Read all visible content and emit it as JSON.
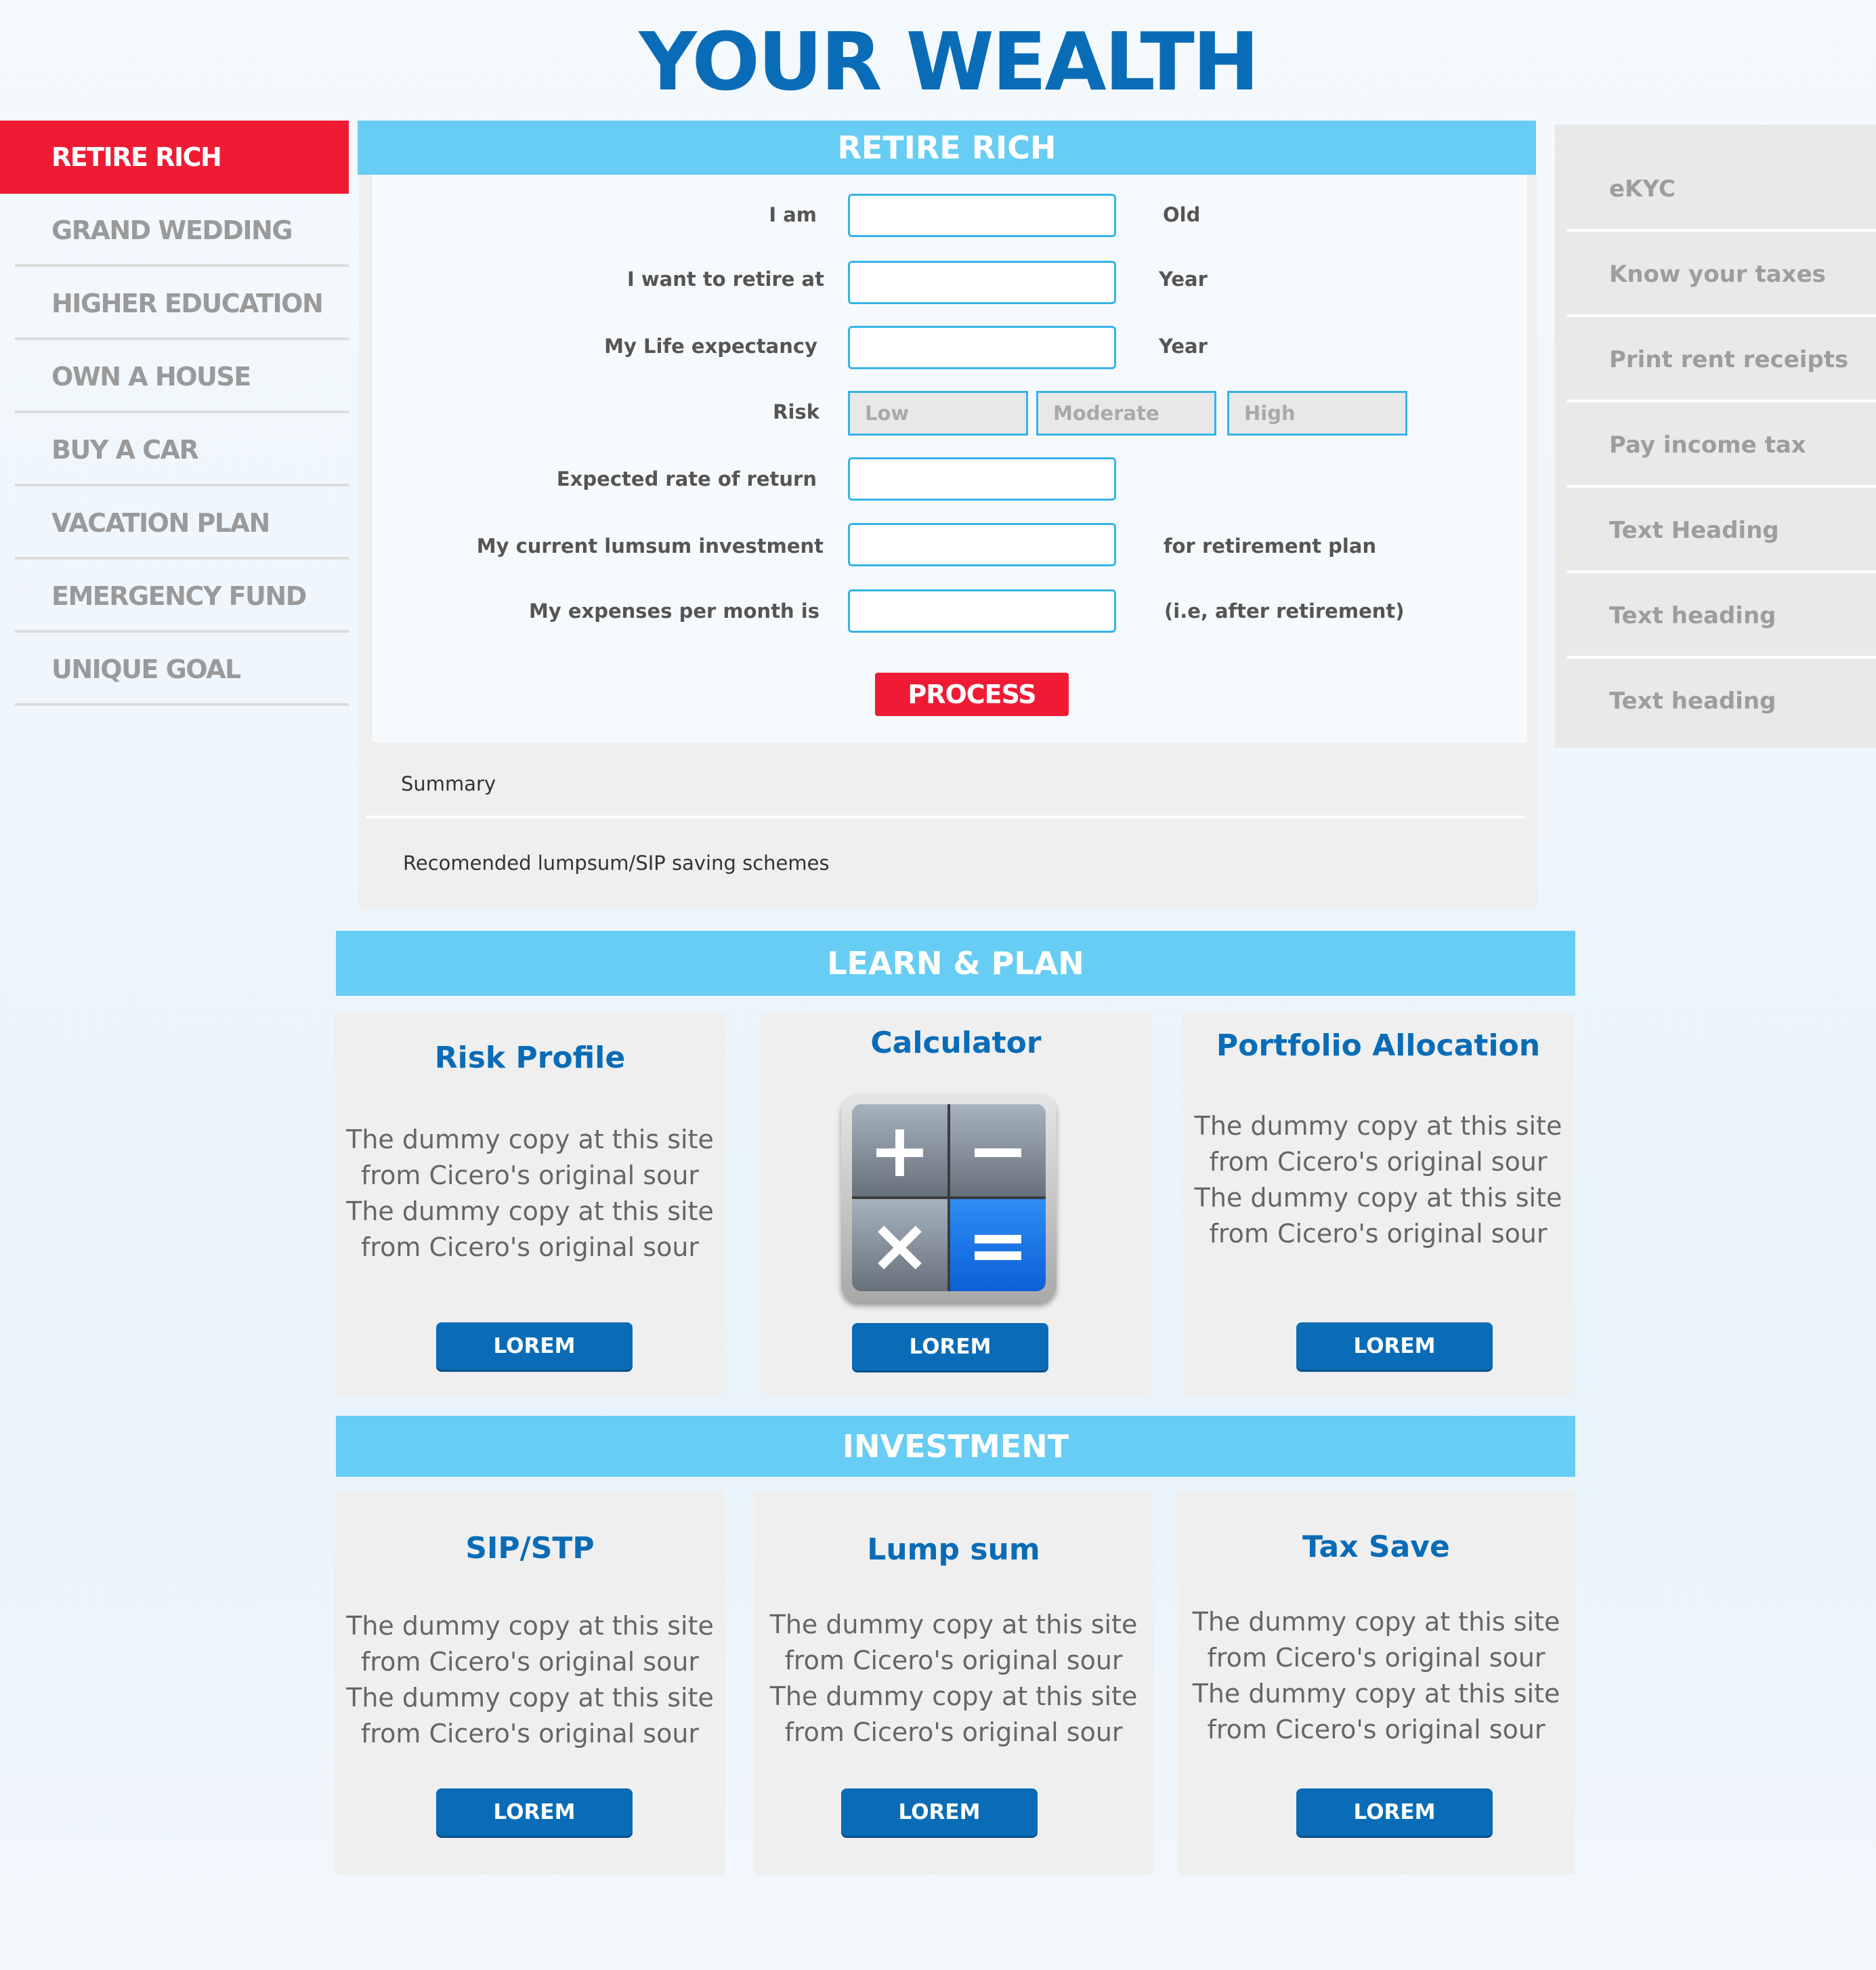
{
  "page_title": "YOUR WEALTH",
  "left_nav": [
    {
      "label": "RETIRE RICH",
      "active": true
    },
    {
      "label": "GRAND WEDDING"
    },
    {
      "label": "HIGHER EDUCATION"
    },
    {
      "label": "OWN A HOUSE"
    },
    {
      "label": "BUY A CAR"
    },
    {
      "label": "VACATION PLAN"
    },
    {
      "label": "EMERGENCY FUND"
    },
    {
      "label": "UNIQUE GOAL"
    }
  ],
  "right_nav": [
    {
      "label": "eKYC"
    },
    {
      "label": "Know your taxes"
    },
    {
      "label": "Print rent receipts"
    },
    {
      "label": "Pay income tax"
    },
    {
      "label": "Text Heading"
    },
    {
      "label": "Text heading"
    },
    {
      "label": "Text heading"
    }
  ],
  "retire_form": {
    "header": "RETIRE RICH",
    "fields": [
      {
        "label": "I am",
        "value": "",
        "suffix": "Old"
      },
      {
        "label": "I want to retire at",
        "value": "",
        "suffix": "Year"
      },
      {
        "label": "My Life expectancy",
        "value": "",
        "suffix": "Year"
      },
      {
        "label": "Expected rate of return",
        "value": "",
        "suffix": ""
      },
      {
        "label": "My current lumsum investment",
        "value": "",
        "suffix": "for retirement plan"
      },
      {
        "label": "My expenses per month is",
        "value": "",
        "suffix": "(i.e, after retirement)"
      }
    ],
    "risk": {
      "label": "Risk",
      "options": [
        "Low",
        "Moderate",
        "High"
      ]
    },
    "process_label": "PROCESS",
    "summary_label": "Summary",
    "recommended_label": "Recomended lumpsum/SIP saving schemes"
  },
  "learn_plan": {
    "header": "LEARN & PLAN",
    "cards": [
      {
        "title": "Risk Profile",
        "lines": [
          "The dummy copy at this site",
          "from Cicero's original sour",
          "The dummy copy at this site",
          "from Cicero's original sour"
        ],
        "button": "LOREM"
      },
      {
        "title": "Calculator",
        "icon": "calculator-icon",
        "button": "LOREM"
      },
      {
        "title": "Portfolio Allocation",
        "lines": [
          "The dummy copy at this site",
          "from Cicero's original sour",
          "The dummy copy at this site",
          "from Cicero's original sour"
        ],
        "button": "LOREM"
      }
    ]
  },
  "investment": {
    "header": "INVESTMENT",
    "cards": [
      {
        "title": "SIP/STP",
        "lines": [
          "The dummy copy at this site",
          "from Cicero's original sour",
          "The dummy copy at this site",
          "from Cicero's original sour"
        ],
        "button": "LOREM"
      },
      {
        "title": "Lump sum",
        "lines": [
          "The dummy copy at this site",
          "from Cicero's original sour",
          "The dummy copy at this site",
          "from Cicero's original sour"
        ],
        "button": "LOREM"
      },
      {
        "title": "Tax Save",
        "lines": [
          "The dummy copy at this site",
          "from Cicero's original sour",
          "The dummy copy at this site",
          "from Cicero's original sour"
        ],
        "button": "LOREM"
      }
    ]
  },
  "colors": {
    "accent_blue": "#0a6cb7",
    "bar_blue": "#68cdf4",
    "active_red": "#ef1b35"
  }
}
